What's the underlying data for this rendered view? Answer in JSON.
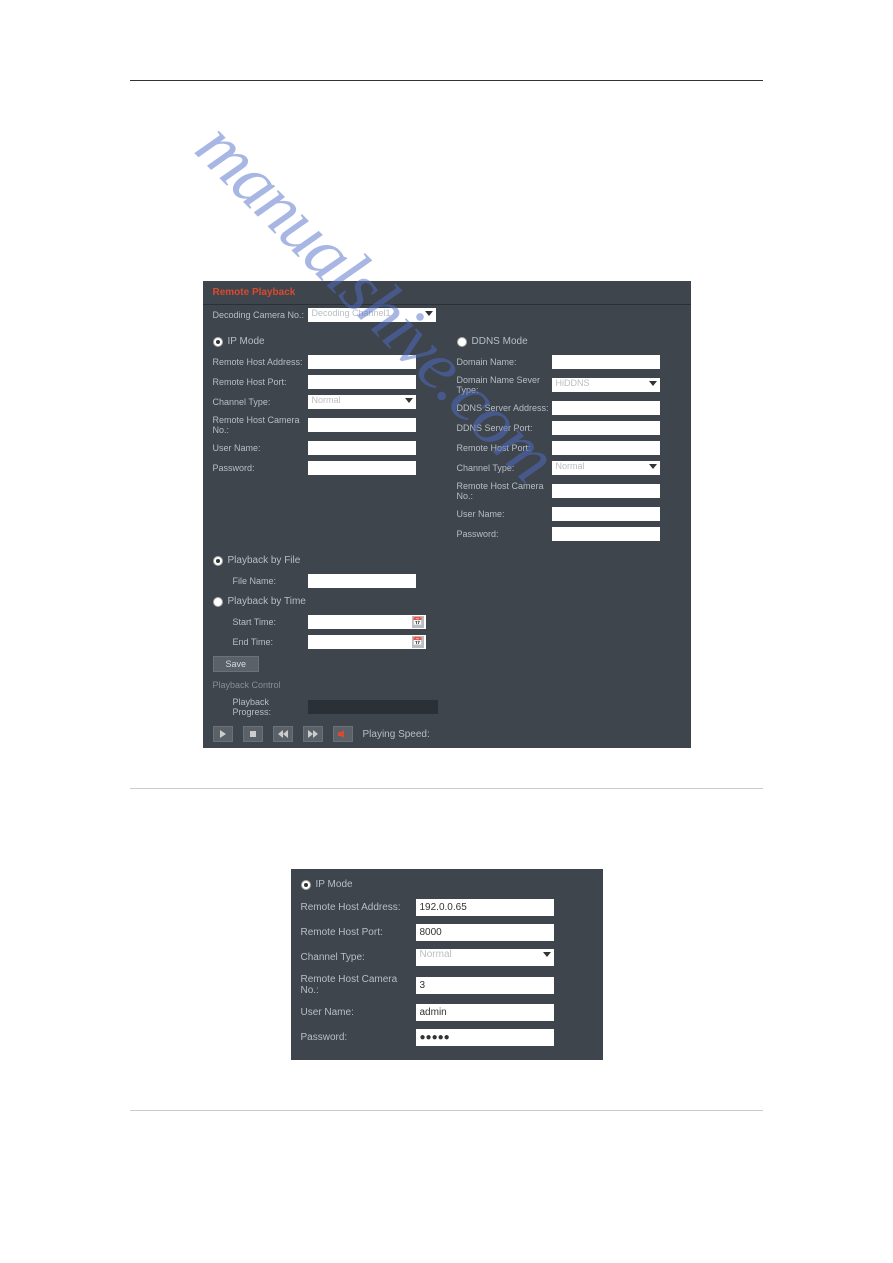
{
  "panel1": {
    "title": "Remote Playback",
    "camera_label": "Decoding Camera No.:",
    "camera_value": "Decoding Channel1",
    "ip_mode": "IP Mode",
    "ddns_mode": "DDNS Mode",
    "remote_host_address": "Remote Host Address:",
    "remote_host_port": "Remote Host Port:",
    "channel_type": "Channel Type:",
    "channel_type_value": "Normal",
    "remote_host_camera_no": "Remote Host Camera No.:",
    "user_name": "User Name:",
    "password": "Password:",
    "domain_name": "Domain Name:",
    "domain_server_type": "Domain Name Sever Type:",
    "domain_server_type_value": "HiDDNS",
    "ddns_server_address": "DDNS Server Address:",
    "ddns_server_port": "DDNS Server Port:",
    "playback_by_file": "Playback by File",
    "file_name": "File Name:",
    "playback_by_time": "Playback by Time",
    "start_time": "Start Time:",
    "end_time": "End Time:",
    "save": "Save",
    "playback_control": "Playback Control",
    "playback_progress": "Playback Progress:",
    "playing_speed": "Playing Speed:"
  },
  "panel2": {
    "ip_mode": "IP Mode",
    "remote_host_address": "Remote Host Address:",
    "remote_host_address_value": "192.0.0.65",
    "remote_host_port": "Remote Host Port:",
    "remote_host_port_value": "8000",
    "channel_type": "Channel Type:",
    "channel_type_value": "Normal",
    "remote_host_camera_no": "Remote Host Camera No.:",
    "remote_host_camera_no_value": "3",
    "user_name": "User Name:",
    "user_name_value": "admin",
    "password": "Password:",
    "password_value": "●●●●●"
  }
}
